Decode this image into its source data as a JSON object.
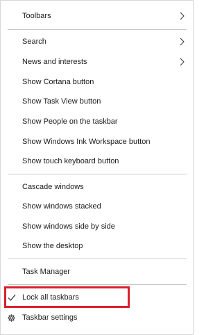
{
  "menu": {
    "items": [
      {
        "label": "Toolbars",
        "has_submenu": true
      },
      {
        "label": "Search",
        "has_submenu": true
      },
      {
        "label": "News and interests",
        "has_submenu": true
      },
      {
        "label": "Show Cortana button"
      },
      {
        "label": "Show Task View button"
      },
      {
        "label": "Show People on the taskbar"
      },
      {
        "label": "Show Windows Ink Workspace button"
      },
      {
        "label": "Show touch keyboard button"
      },
      {
        "label": "Cascade windows"
      },
      {
        "label": "Show windows stacked"
      },
      {
        "label": "Show windows side by side"
      },
      {
        "label": "Show the desktop"
      },
      {
        "label": "Task Manager"
      },
      {
        "label": "Lock all taskbars",
        "checked": true,
        "icon": "checkmark-icon"
      },
      {
        "label": "Taskbar settings",
        "icon": "gear-icon"
      }
    ]
  },
  "colors": {
    "highlight_border": "#d91f2a",
    "separator": "#c8c8c8",
    "text": "#1a1a1a"
  }
}
